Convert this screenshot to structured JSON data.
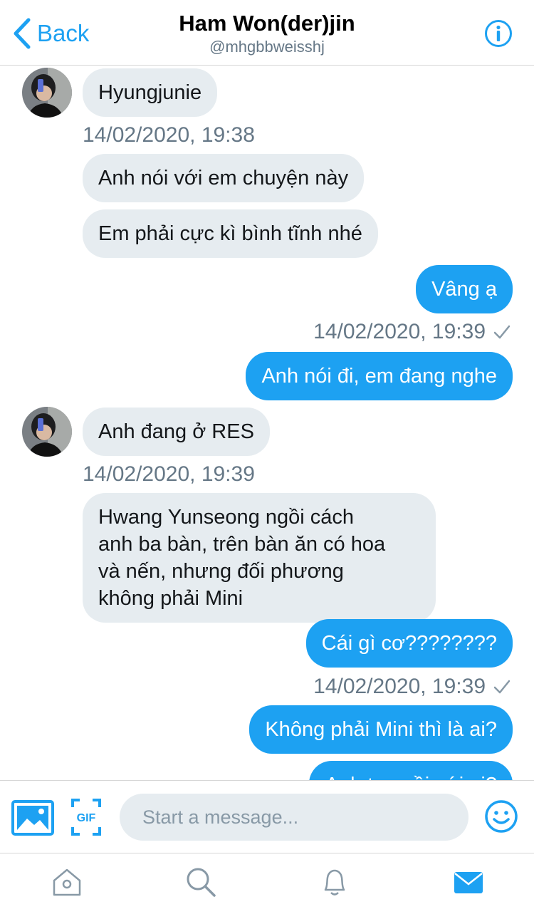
{
  "header": {
    "back_label": "Back",
    "title": "Ham Won(der)jin",
    "handle": "@mhgbbweisshj"
  },
  "messages": [
    {
      "side": "received",
      "text": "Hyungjunie"
    },
    {
      "side": "timestamp-received",
      "text": "14/02/2020, 19:38"
    },
    {
      "side": "received",
      "text": "Anh nói với em chuyện này"
    },
    {
      "side": "received",
      "text": "Em phải cực kì bình tĩnh nhé"
    },
    {
      "side": "sent",
      "text": "Vâng ạ"
    },
    {
      "side": "timestamp-sent",
      "text": "14/02/2020, 19:39"
    },
    {
      "side": "sent",
      "text": "Anh nói đi, em đang nghe"
    },
    {
      "side": "received",
      "text": "Anh đang ở RES"
    },
    {
      "side": "timestamp-received",
      "text": "14/02/2020, 19:39"
    },
    {
      "side": "received",
      "text": "Hwang Yunseong ngồi cách\nanh ba bàn, trên bàn ăn có hoa\nvà nến, nhưng đối phương\nkhông phải Mini"
    },
    {
      "side": "sent",
      "text": "Cái gì cơ????????"
    },
    {
      "side": "timestamp-sent",
      "text": "14/02/2020, 19:39"
    },
    {
      "side": "sent",
      "text": "Không phải Mini thì là ai?"
    },
    {
      "side": "sent",
      "text": "Anh ta ngồi với ai?"
    }
  ],
  "composer": {
    "placeholder": "Start a message...",
    "gif_label": "GIF"
  },
  "tabs": [
    "home-icon",
    "search-icon",
    "notifications-icon",
    "messages-icon"
  ],
  "colors": {
    "accent": "#1da1f2",
    "received_bubble": "#e6ecf0",
    "muted_text": "#657786",
    "inactive_icon": "#8899a6"
  }
}
